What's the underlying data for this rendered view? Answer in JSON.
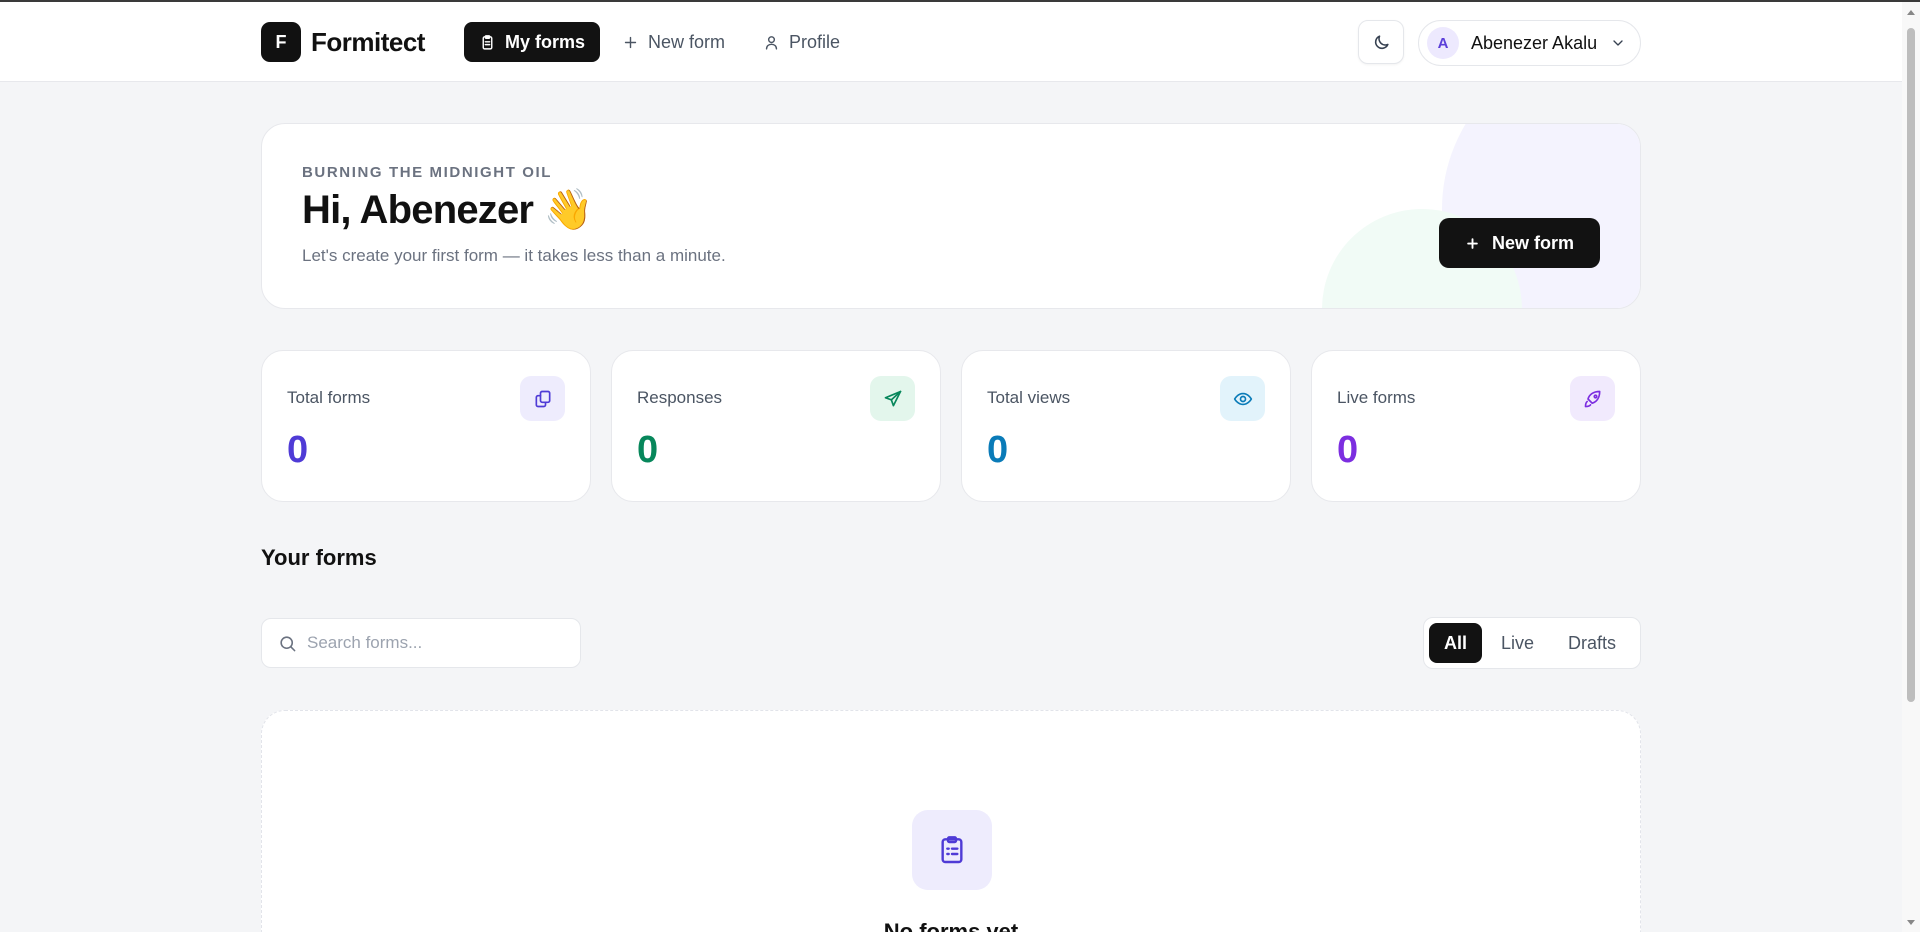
{
  "brand": {
    "logo_letter": "F",
    "name": "Formitect"
  },
  "nav": {
    "items": [
      {
        "label": "My forms",
        "icon": "clipboard-icon",
        "active": true
      },
      {
        "label": "New form",
        "icon": "plus-icon",
        "active": false
      },
      {
        "label": "Profile",
        "icon": "user-icon",
        "active": false
      }
    ]
  },
  "header": {
    "theme_toggle_icon": "moon-icon",
    "user": {
      "initial": "A",
      "name": "Abenezer Akalu"
    }
  },
  "hero": {
    "eyebrow": "BURNING THE MIDNIGHT OIL",
    "title": "Hi, Abenezer 👋",
    "subtitle": "Let's create your first form — it takes less than a minute.",
    "button_label": "New form"
  },
  "stats": [
    {
      "label": "Total forms",
      "value": "0",
      "color": "#4f3bd6",
      "icon": "copy-icon",
      "icon_bg": "#eeecfd"
    },
    {
      "label": "Responses",
      "value": "0",
      "color": "#07875b",
      "icon": "send-icon",
      "icon_bg": "#e3f6ec"
    },
    {
      "label": "Total views",
      "value": "0",
      "color": "#0a7bb8",
      "icon": "eye-icon",
      "icon_bg": "#e2f3fb"
    },
    {
      "label": "Live forms",
      "value": "0",
      "color": "#7c2ee0",
      "icon": "rocket-icon",
      "icon_bg": "#f1eafd"
    }
  ],
  "forms_section": {
    "title": "Your forms",
    "search_placeholder": "Search forms...",
    "filters": [
      {
        "label": "All",
        "active": true
      },
      {
        "label": "Live",
        "active": false
      },
      {
        "label": "Drafts",
        "active": false
      }
    ],
    "empty_title": "No forms yet"
  }
}
